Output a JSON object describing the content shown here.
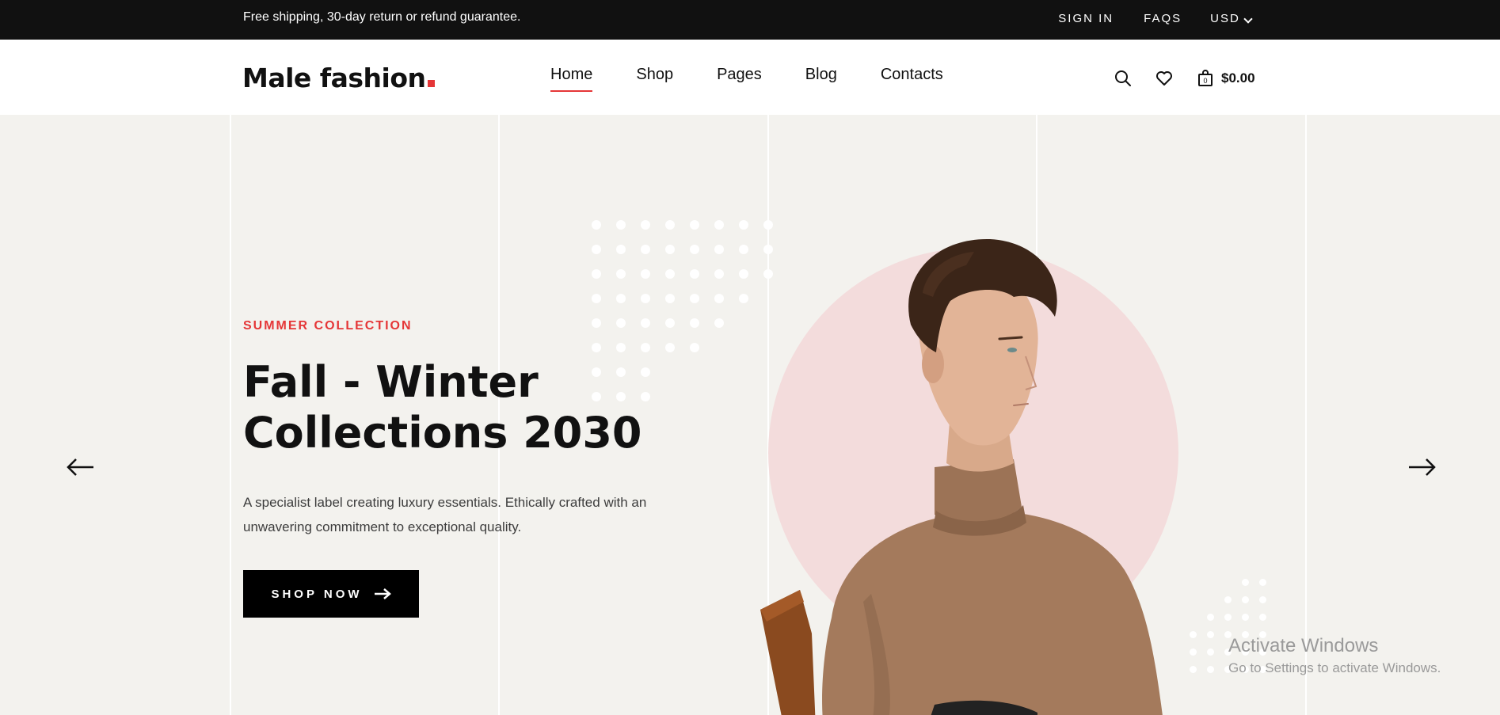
{
  "topbar": {
    "shipping_text": "Free shipping, 30-day return or refund guarantee.",
    "sign_in": "SIGN IN",
    "faqs": "FAQS",
    "currency": "USD"
  },
  "header": {
    "logo_text": "Male fashion",
    "nav": [
      "Home",
      "Shop",
      "Pages",
      "Blog",
      "Contacts"
    ],
    "active_nav": "Home",
    "cart_total": "$0.00",
    "cart_count": "0"
  },
  "hero": {
    "subtitle": "SUMMER COLLECTION",
    "headline_line1": "Fall - Winter",
    "headline_line2": "Collections 2030",
    "description": "A specialist label creating luxury essentials. Ethically crafted with an unwavering commitment to exceptional quality.",
    "cta_label": "SHOP NOW"
  },
  "watermark": {
    "title": "Activate Windows",
    "subtitle": "Go to Settings to activate Windows."
  },
  "colors": {
    "accent": "#e53637",
    "topbar_bg": "#111111",
    "hero_bg": "#f3f2ee",
    "circle": "#f3dcdc",
    "sweater": "#a47a5c"
  },
  "icons": [
    "search-icon",
    "heart-icon",
    "bag-icon",
    "chevron-down-icon",
    "arrow-left-icon",
    "arrow-right-icon",
    "arrow-right-small-icon"
  ]
}
